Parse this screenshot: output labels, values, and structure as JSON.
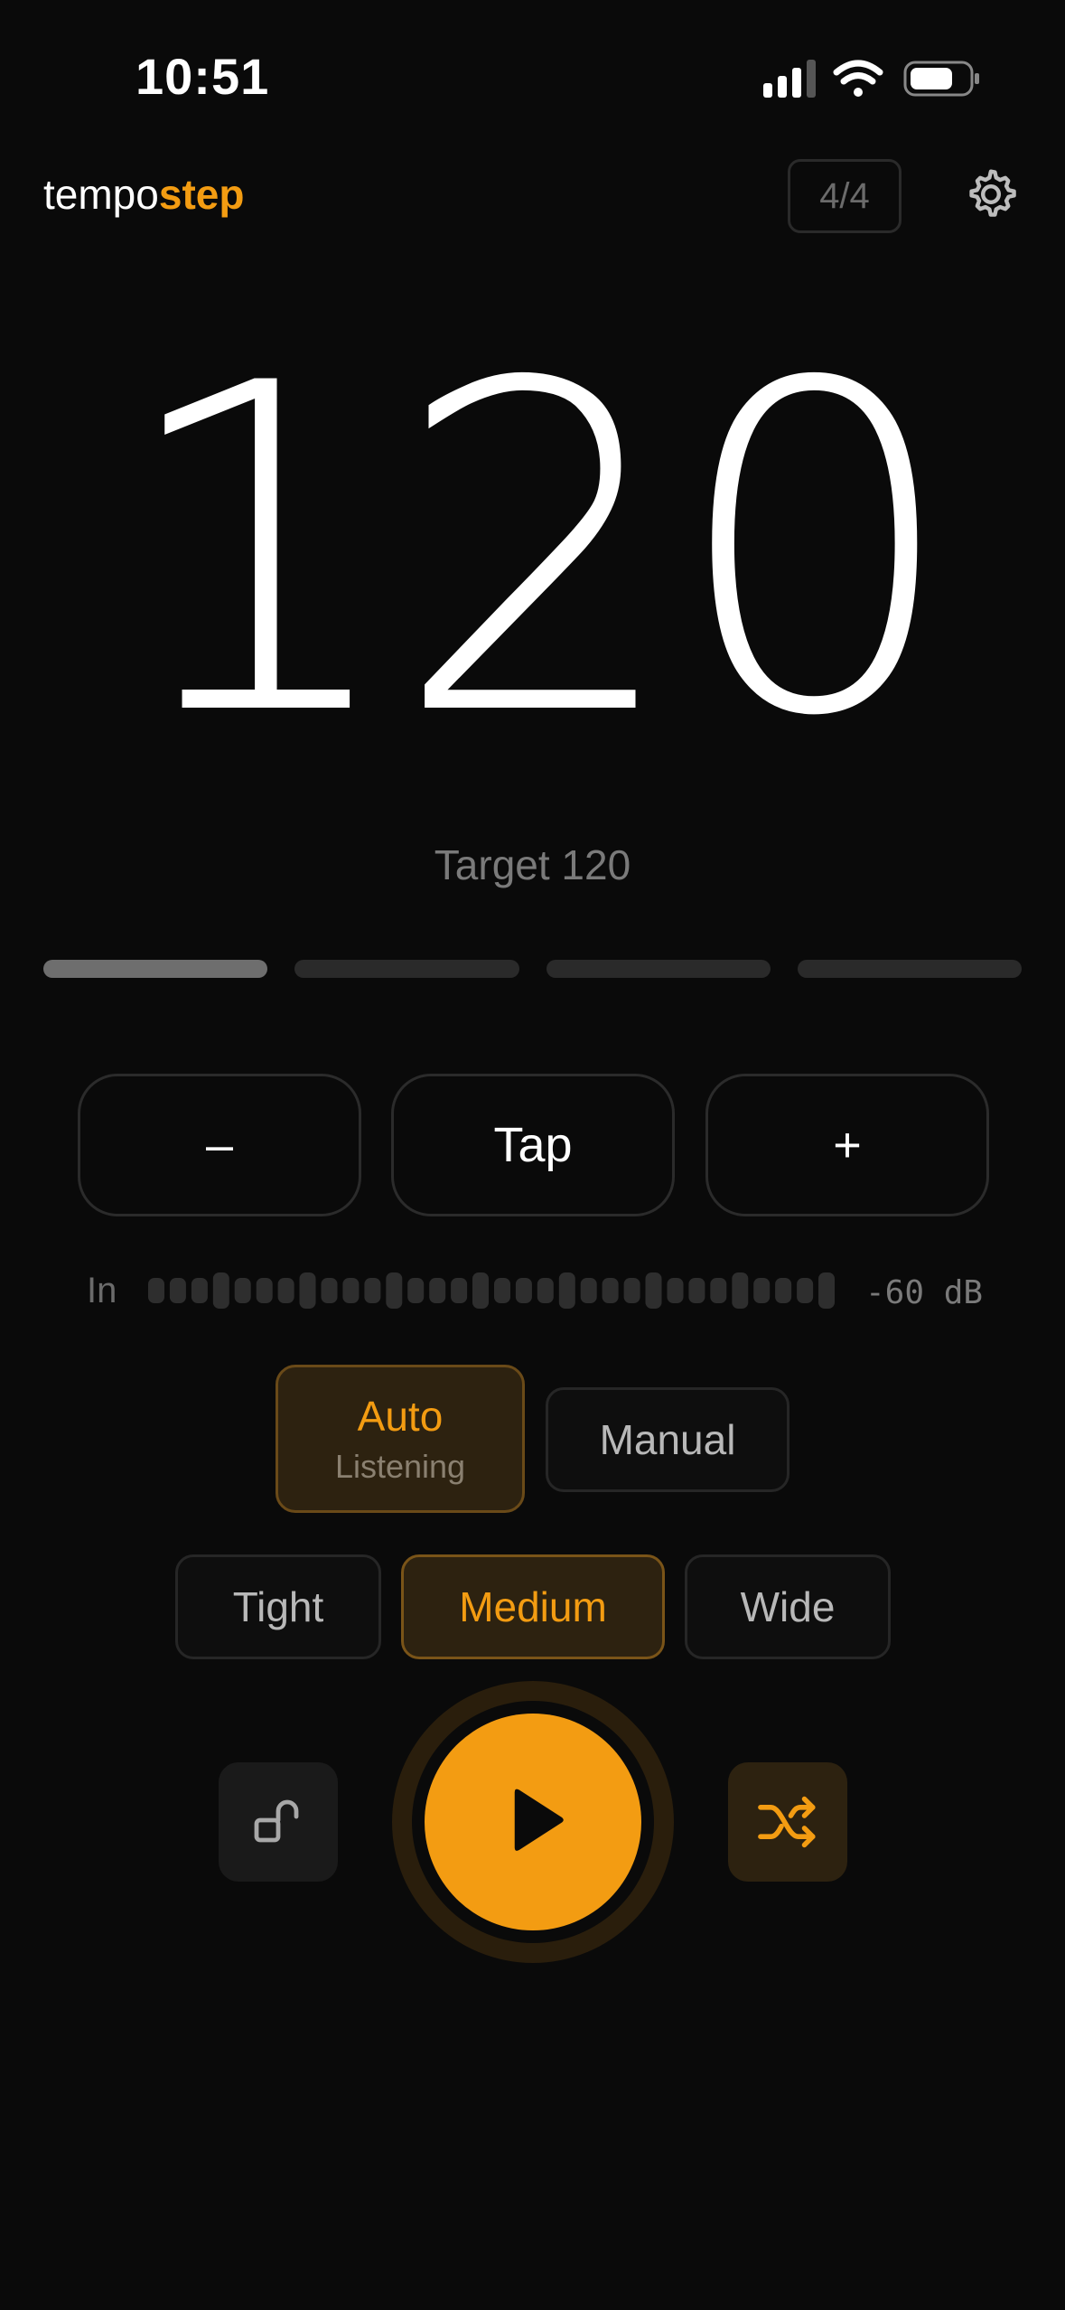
{
  "status": {
    "time": "10:51"
  },
  "header": {
    "brand_part1": "tempo",
    "brand_part2": "step",
    "time_signature": "4/4"
  },
  "tempo": {
    "bpm": "120",
    "target": "Target 120"
  },
  "beats": {
    "count": 4,
    "active_index": 0
  },
  "controls": {
    "minus": "–",
    "tap": "Tap",
    "plus": "+"
  },
  "input": {
    "label": "In",
    "level": "-60 dB"
  },
  "mode": {
    "auto": "Auto",
    "auto_status": "Listening",
    "manual": "Manual",
    "selected": "Auto"
  },
  "range": {
    "options": [
      "Tight",
      "Medium",
      "Wide"
    ],
    "selected": "Medium"
  },
  "colors": {
    "accent": "#f39c12",
    "background": "#0a0a0a"
  },
  "icons": {
    "settings": "gear-icon",
    "lock": "unlock-icon",
    "play": "play-icon",
    "shuffle": "shuffle-icon"
  }
}
